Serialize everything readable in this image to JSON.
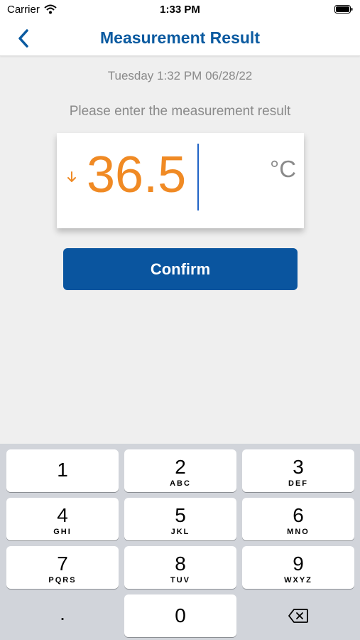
{
  "status_bar": {
    "carrier": "Carrier",
    "time": "1:33 PM"
  },
  "nav": {
    "title": "Measurement Result"
  },
  "timestamp": "Tuesday 1:32 PM 06/28/22",
  "prompt": "Please enter the measurement result",
  "measurement": {
    "value": "36.5",
    "unit": "°C"
  },
  "confirm_label": "Confirm",
  "keyboard": {
    "keys": [
      {
        "num": "1",
        "letters": ""
      },
      {
        "num": "2",
        "letters": "ABC"
      },
      {
        "num": "3",
        "letters": "DEF"
      },
      {
        "num": "4",
        "letters": "GHI"
      },
      {
        "num": "5",
        "letters": "JKL"
      },
      {
        "num": "6",
        "letters": "MNO"
      },
      {
        "num": "7",
        "letters": "PQRS"
      },
      {
        "num": "8",
        "letters": "TUV"
      },
      {
        "num": "9",
        "letters": "WXYZ"
      }
    ],
    "dot": ".",
    "zero": "0"
  },
  "colors": {
    "accent": "#0a5aa0",
    "value": "#f08a24",
    "button": "#0a559f",
    "cursor": "#1f63c6"
  },
  "icons": [
    "wifi-icon",
    "battery-icon",
    "back-chevron-icon",
    "down-arrow-icon",
    "backspace-icon"
  ]
}
